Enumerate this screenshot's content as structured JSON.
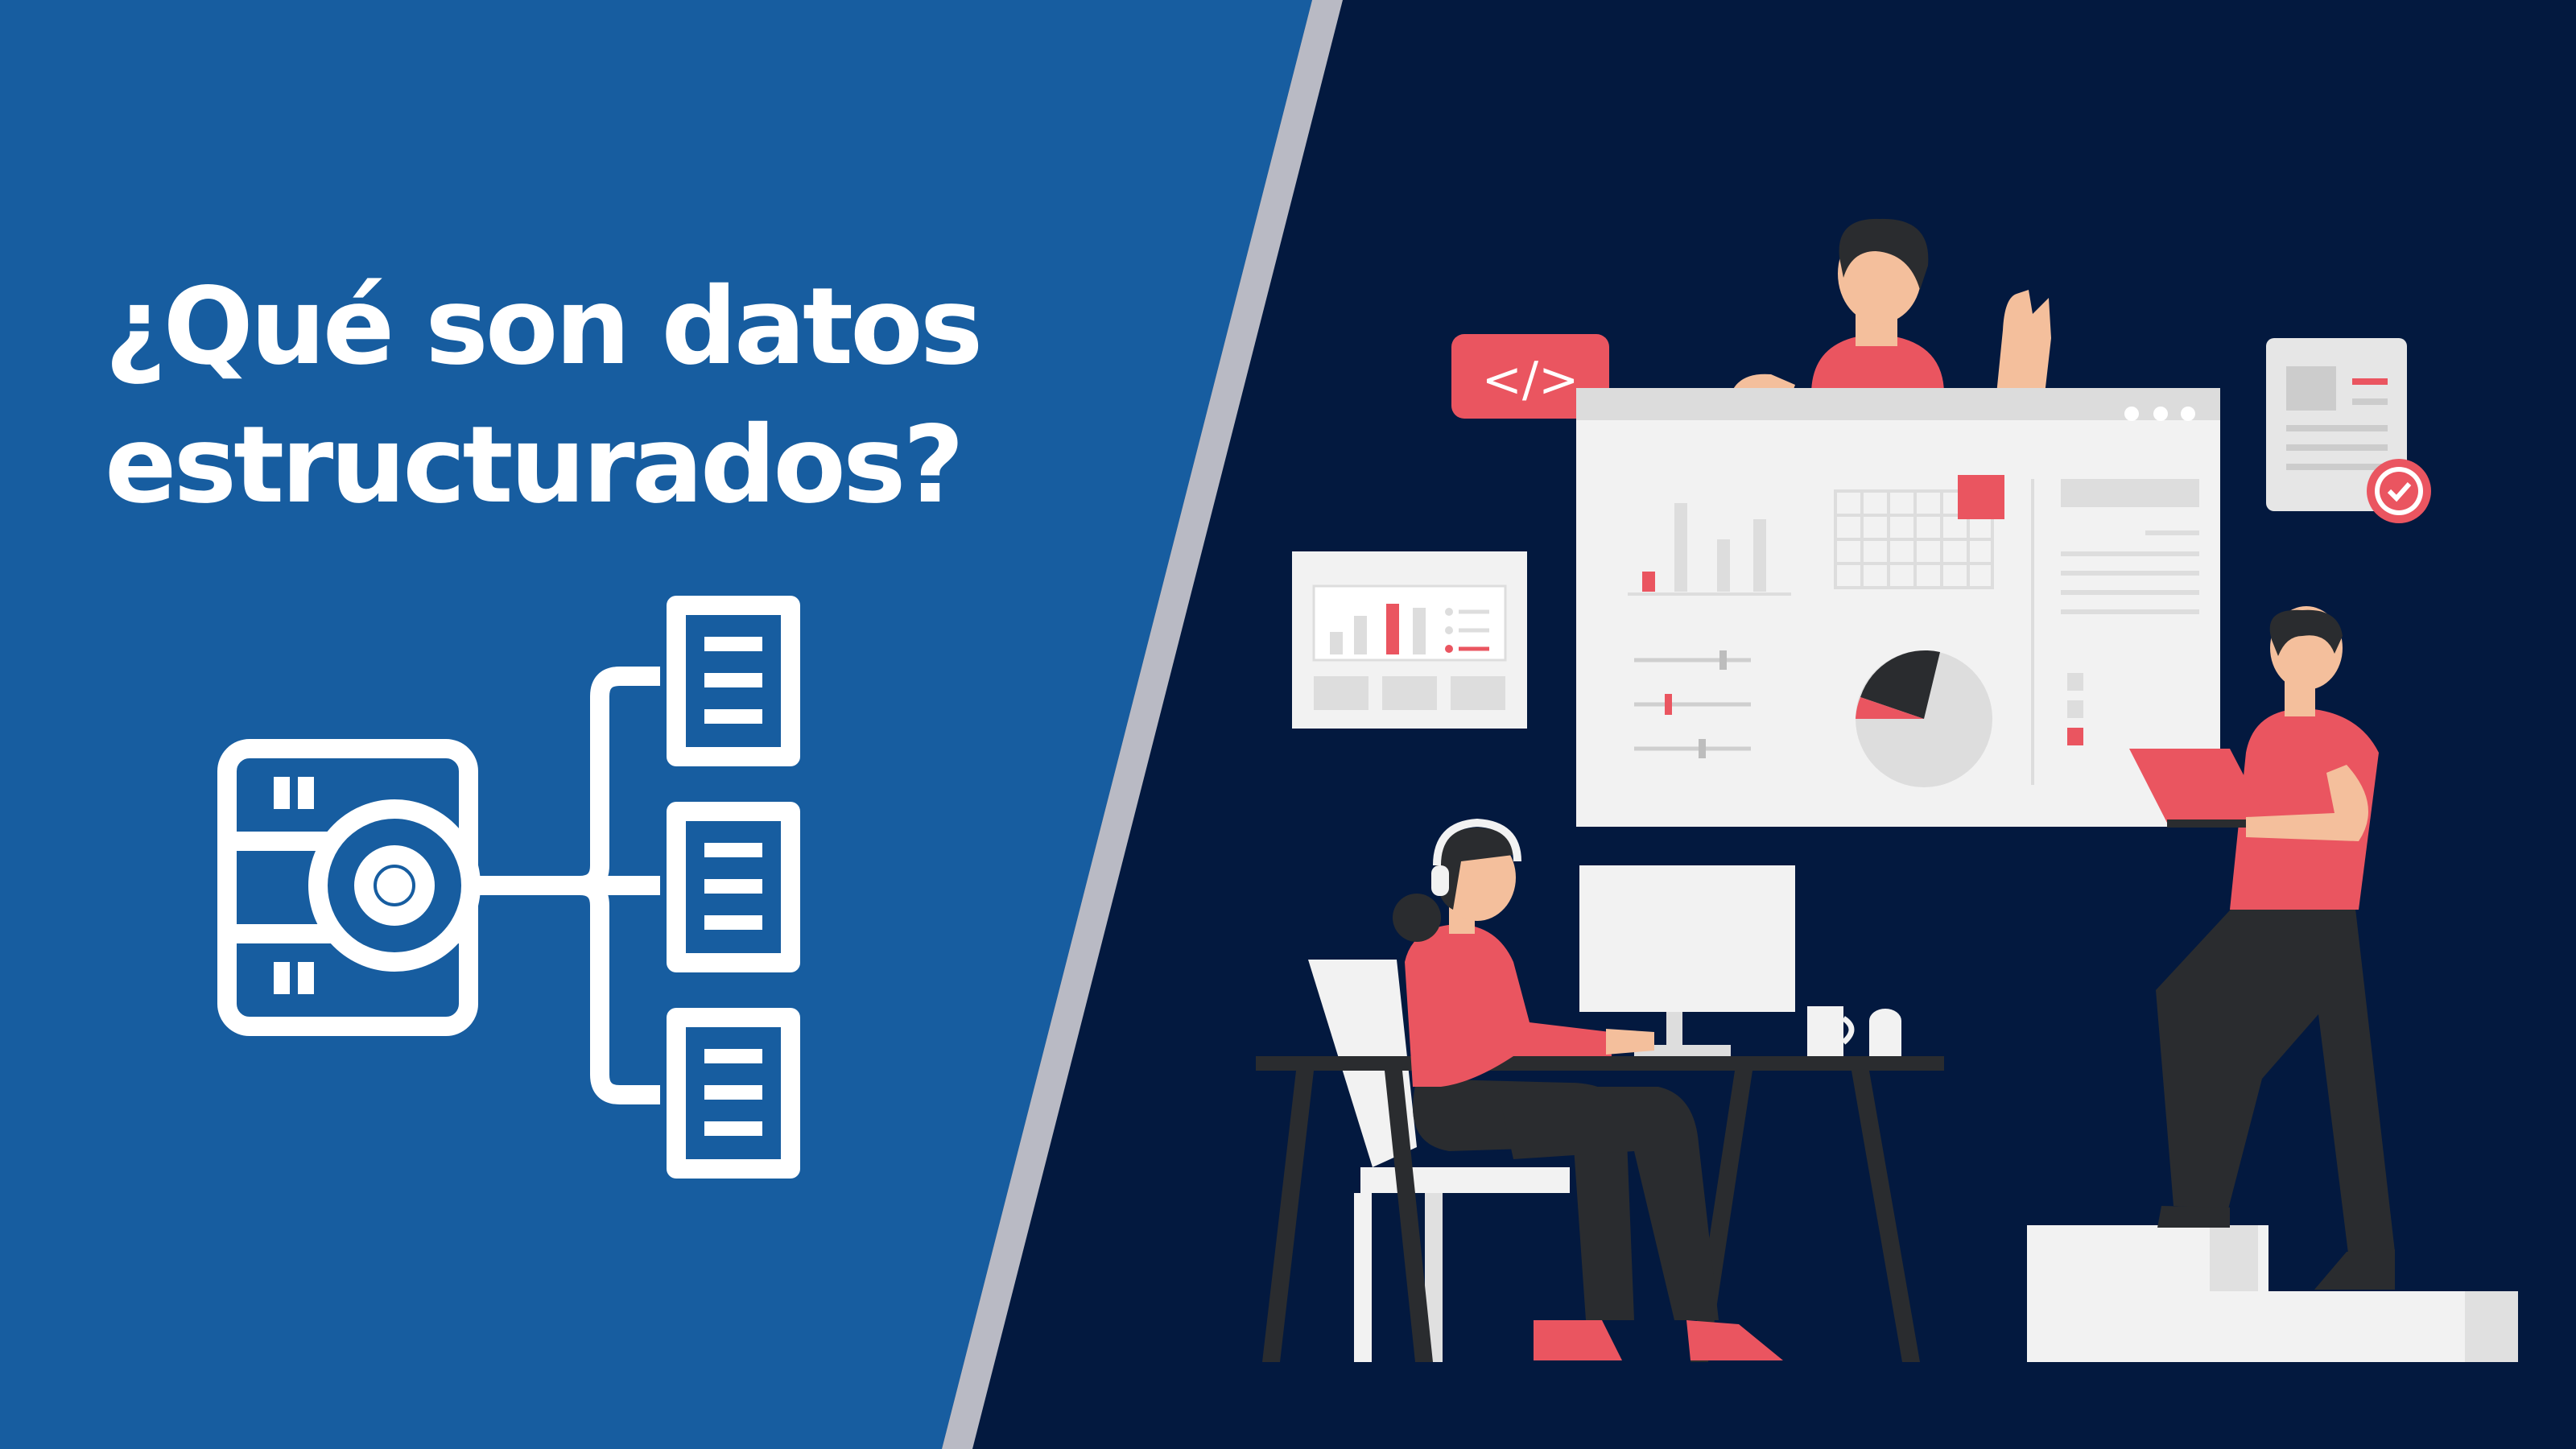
{
  "headline": {
    "line1": "¿Qué son datos",
    "line2": "estructurados?"
  },
  "colors": {
    "left_panel": "#175da0",
    "right_panel": "#03193f",
    "divider": "#b9bac4",
    "accent": "#ea5560",
    "light_gray": "#f2f2f2",
    "dark_gray": "#2a2c2f",
    "skin": "#f4bf9c"
  },
  "icons": {
    "structured_data": "database-network-icon",
    "code_badge": "code-brackets-icon",
    "check_badge": "checkmark-icon"
  },
  "illustration": {
    "code_tag_text": "</>"
  }
}
